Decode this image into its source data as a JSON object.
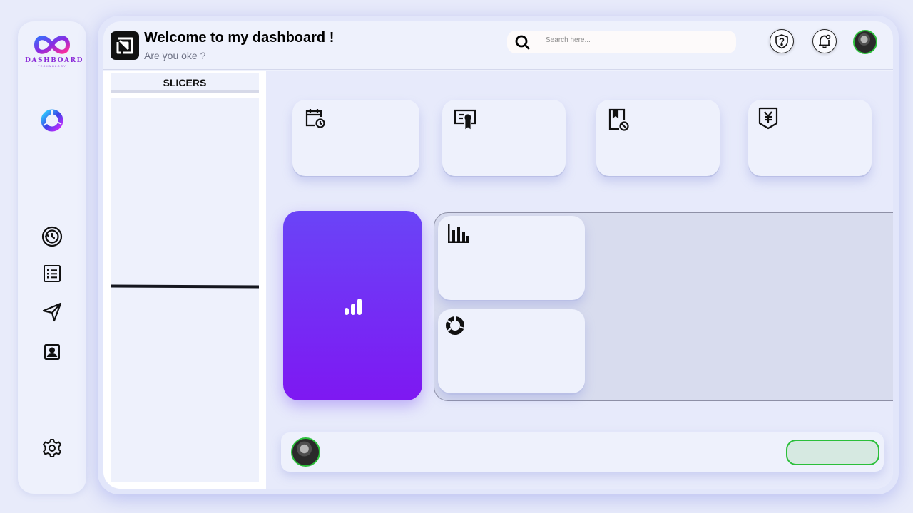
{
  "sidebar": {
    "logo": {
      "text": "DASHBOARD",
      "sub": "TECHNOLOGY"
    },
    "items": [
      {
        "name": "donut-logo-icon"
      },
      {
        "name": "history-icon"
      },
      {
        "name": "list-icon"
      },
      {
        "name": "send-icon"
      },
      {
        "name": "contact-icon"
      },
      {
        "name": "gear-icon"
      }
    ]
  },
  "header": {
    "title": "Welcome to my dashboard !",
    "subtitle": "Are you oke ?",
    "search_placeholder": "Search here..."
  },
  "slicers": {
    "title": "SLICERS"
  },
  "cards": [
    {
      "icon": "calendar-clock-icon"
    },
    {
      "icon": "certificate-icon"
    },
    {
      "icon": "bookmark-block-icon"
    },
    {
      "icon": "yen-shield-icon"
    }
  ],
  "small_cards": [
    {
      "icon": "bar-chart-icon"
    },
    {
      "icon": "donut-chart-icon"
    }
  ],
  "colors": {
    "accent_purple": "#7e18f2",
    "green_border": "#2bbf3a",
    "background": "#e8ebfa"
  }
}
